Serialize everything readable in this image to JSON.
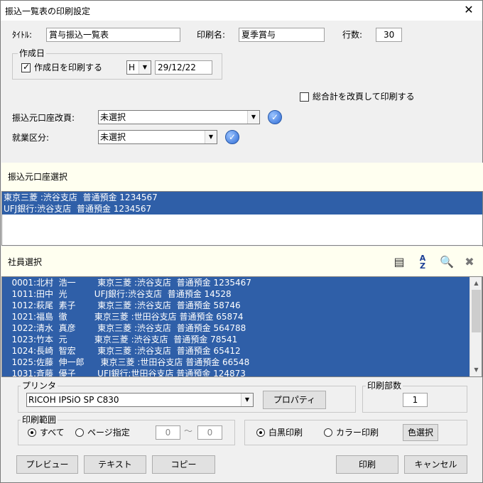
{
  "window": {
    "title": "振込一覧表の印刷設定",
    "close_label": "✕"
  },
  "fields": {
    "title_label": "ﾀｲﾄﾙ:",
    "title_value": "賞与振込一覧表",
    "print_name_label": "印刷名:",
    "print_name_value": "夏季賞与",
    "rows_label": "行数:",
    "rows_value": "30"
  },
  "creation_date": {
    "group_label": "作成日",
    "print_date_label": "作成日を印刷する",
    "print_date_checked": true,
    "era_value": "H",
    "date_value": "29/12/22"
  },
  "total_page_break_label": "総合計を改頁して印刷する",
  "source_account_page_break": {
    "label": "振込元口座改頁:",
    "value": "未選択"
  },
  "employment_type": {
    "label": "就業区分:",
    "value": "未選択"
  },
  "source_account_section": {
    "header": "振込元口座選択",
    "items": [
      "東京三菱 :渋谷支店  普通預金 1234567",
      "UFJ銀行:渋谷支店  普通預金 1234567"
    ]
  },
  "employee_section": {
    "header": "社員選択",
    "rows": [
      "   0001:北村  浩一        東京三菱 :渋谷支店  普通預金 1235467",
      "   1011:田中  光          UFJ銀行:渋谷支店  普通預金 14528",
      "   1012:萩尾  素子        東京三菱 :渋谷支店  普通預金 58746",
      "   1021:福島  徹          東京三菱 :世田谷支店 普通預金 65874",
      "   1022:清水  真彦        東京三菱 :渋谷支店  普通預金 564788",
      "   1023:竹本  元          東京三菱 :渋谷支店  普通預金 78541",
      "   1024:長崎  智宏        東京三菱 :渋谷支店  普通預金 65412",
      "   1025:佐藤  伸一郎      東京三菱 :世田谷支店 普通預金 66548",
      "   1031:斉藤  優子        UFJ銀行:世田谷支店 普通預金 124873"
    ],
    "icons": [
      "list-view-icon",
      "sort-az-icon",
      "search-icon",
      "search-clear-icon"
    ]
  },
  "printer": {
    "group_label": "プリンタ",
    "selected": "RICOH IPSiO SP C830",
    "properties_label": "プロパティ"
  },
  "copies": {
    "group_label": "印刷部数",
    "value": "1"
  },
  "print_range": {
    "group_label": "印刷範囲",
    "all_label": "すべて",
    "page_label": "ページ指定",
    "selected": "all",
    "from": "0",
    "separator": "〜",
    "to": "0"
  },
  "color_mode": {
    "mono_label": "白黒印刷",
    "color_label": "カラー印刷",
    "selected": "mono",
    "color_select_label": "色選択"
  },
  "buttons": {
    "preview": "プレビュー",
    "text": "テキスト",
    "copy": "コピー",
    "print": "印刷",
    "cancel": "キャンセル"
  },
  "colors": {
    "selection": "#2f5fa8",
    "section_band": "#fffff0",
    "dialog_bg": "#f0f0f0"
  }
}
